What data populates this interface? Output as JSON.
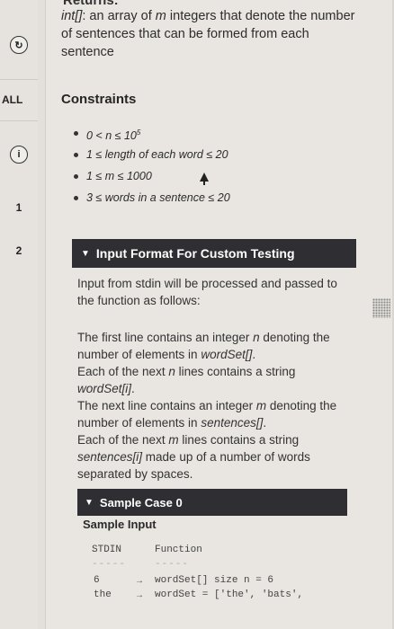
{
  "rail": {
    "icon_top": "refresh-icon",
    "all_label": "ALL",
    "info_icon": "info-icon",
    "item_1": "1",
    "item_2": "2"
  },
  "returns": {
    "heading_cut": "Returns:",
    "type": "int[]",
    "desc_mid": ": an array of ",
    "m": "m",
    "desc_end": " integers that denote the number of sentences that can be formed from each sentence"
  },
  "constraints": {
    "heading": "Constraints",
    "items": [
      "0 < n ≤ 10",
      "1 ≤ length of each word ≤ 20",
      "1 ≤ m ≤ 1000",
      "3 ≤  words in a sentence ≤ 20"
    ],
    "exp": "5"
  },
  "input_format": {
    "title": "Input Format For Custom Testing",
    "intro": "Input from stdin will be processed and passed to the function as follows:",
    "p1": "The first line contains an integer ",
    "p1_n": "n",
    "p1b": " denoting the number of elements in ",
    "p1_arr": "wordSet[]",
    "p1c": ".",
    "p2": "Each of the next ",
    "p2_n": "n",
    "p2b": " lines contains a string ",
    "p2_arr": "wordSet[i]",
    "p2c": ".",
    "p3": "The next line contains an integer ",
    "p3_m": "m",
    "p3b": " denoting the number of elements in ",
    "p3_arr": "sentences[]",
    "p3c": ".",
    "p4": "Each of the next ",
    "p4_m": "m",
    "p4b": " lines contains a string ",
    "p4_arr": "sentences[i]",
    "p4c": " made up of a number of words separated by spaces."
  },
  "sample": {
    "title": "Sample Case 0",
    "input_label": "Sample Input",
    "col_stdin": "STDIN",
    "col_function": "Function",
    "dash_stdin": "-----",
    "dash_function": "-----",
    "rows": [
      {
        "stdin": "6",
        "function": "wordSet[] size n = 6"
      },
      {
        "stdin": "the",
        "function": "wordSet = ['the', 'bats',"
      }
    ]
  }
}
